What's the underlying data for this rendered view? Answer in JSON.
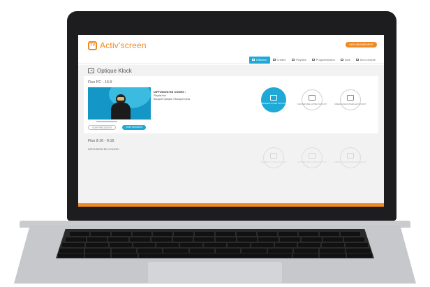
{
  "app": {
    "logo_mark": "TV",
    "logo_text": "Activ'screen",
    "subscribe_pill": "MON ABONNEMENT"
  },
  "nav": [
    {
      "label": "Diffusion",
      "active": true
    },
    {
      "label": "Créativ'",
      "active": false
    },
    {
      "label": "Playlists",
      "active": false
    },
    {
      "label": "Programmation",
      "active": false
    },
    {
      "label": "Aide",
      "active": false
    },
    {
      "label": "Mon compte",
      "active": false
    }
  ],
  "page": {
    "title": "Optique Klock"
  },
  "flux_pc": {
    "title": "Flux PC - 16:9",
    "diffusion_label": "DIFFUSION EN COURS :",
    "lines": [
      "Playlist fixe",
      "Bouquet Optique / Bouquet Infos"
    ],
    "prev_button": "VOIR PRÉCÉDENT",
    "next_button": "VOIR SUIVANTE"
  },
  "flux_vertical": {
    "title": "Flux 9:16 - 9:16",
    "diffusion_label": "DIFFUSION EN COURS :"
  },
  "actions": [
    {
      "label": "MODIFIER VOTRE PLAYLIST",
      "icon": "edit-screen-icon"
    },
    {
      "label": "CHOISIR UNE AUTRE PLAYLIST",
      "icon": "playlist-swap-icon"
    },
    {
      "label": "CRÉER UNE NOUVELLE PLAYLIST",
      "icon": "add-playlist-icon"
    }
  ],
  "colors": {
    "brand_orange": "#f08a24",
    "accent_blue": "#1fa9d6"
  }
}
